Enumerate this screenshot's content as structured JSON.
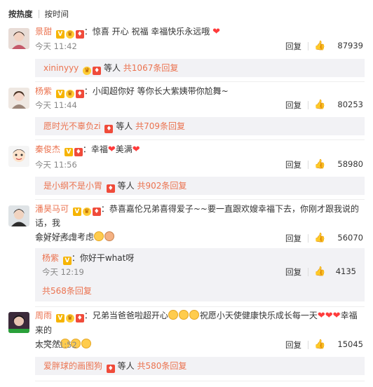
{
  "sort": {
    "hot": "按热度",
    "time": "按时间"
  },
  "comments": [
    {
      "user": "景甜",
      "text": "：惊喜 开心 祝福 幸福快乐永远哦",
      "time": "今天 11:42",
      "reply_label": "回复",
      "likes": "87939",
      "replies": {
        "user": "xininyyy",
        "mid": "等人",
        "more": "共1067条回复"
      }
    },
    {
      "user": "杨紫",
      "text": "：小闺超你好 等你长大紫姨带你尬舞~",
      "time": "今天 11:44",
      "reply_label": "回复",
      "likes": "80253",
      "replies": {
        "user": "愿时光不辜负zi",
        "mid": "等人",
        "more": "共709条回复"
      }
    },
    {
      "user": "秦俊杰",
      "text": "：幸福",
      "text2": "美满",
      "time": "今天 11:56",
      "reply_label": "回复",
      "likes": "58980",
      "replies": {
        "user": "是小纲不是小胃",
        "mid": "等人",
        "more": "共902条回复"
      }
    },
    {
      "user": "潘昊马可",
      "text": "：恭喜嘉伦兄弟喜得爱子~~要一直跟欢嫂幸福下去，你刚才跟我说的话，我",
      "text_line2": "会好好考虑考虑",
      "time": "今天 11:44",
      "reply_label": "回复",
      "likes": "56070",
      "subreply": {
        "user": "杨紫",
        "text": "：你好干what呀",
        "time": "今天 12:19",
        "reply_label": "回复",
        "likes": "4135"
      },
      "more": "共568条回复"
    },
    {
      "user": "周雨",
      "text": "：兄弟当爸爸啦超开心",
      "text_b": "祝愿小天使健康快乐成长每一天",
      "text_c": "幸福来的",
      "text_line2": "太突然",
      "time": "今天 11:52",
      "reply_label": "回复",
      "likes": "15045",
      "replies": {
        "user": "爱胖球的画图狗",
        "mid": "等人",
        "more": "共580条回复"
      }
    }
  ],
  "icons": {
    "verified": "V",
    "crown": "crown-icon",
    "vip": "vip-badge",
    "thumb": "thumb-up-icon",
    "heart": "❤"
  },
  "colors": {
    "username": "#eb7350",
    "reply_bg": "#f2f2f5",
    "heart": "#ff3b3b"
  }
}
